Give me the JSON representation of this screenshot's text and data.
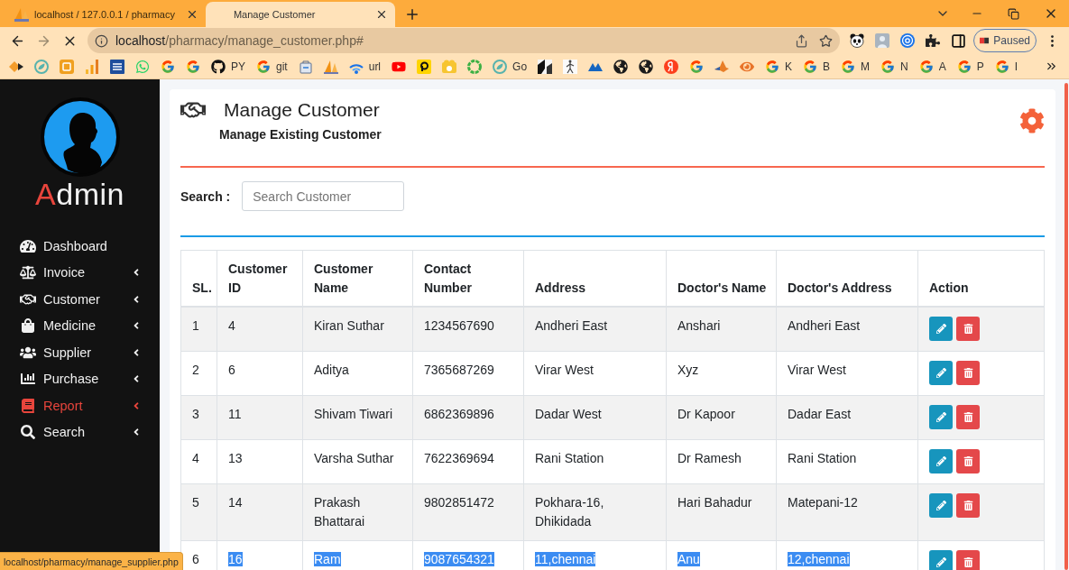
{
  "browser": {
    "tabs": [
      {
        "title": "localhost / 127.0.0.1 / pharmacy",
        "has_icon": true,
        "selected": false
      },
      {
        "title": "Manage Customer",
        "has_icon": false,
        "selected": true
      }
    ],
    "can_go_forward": false,
    "loading": true,
    "address": {
      "host": "localhost",
      "path": "/pharmacy/manage_customer.php#"
    },
    "profile_status": "Paused",
    "bookmarks": [
      {
        "kind": "icon"
      },
      {
        "kind": "icon"
      },
      {
        "kind": "icon"
      },
      {
        "kind": "icon"
      },
      {
        "kind": "icon"
      },
      {
        "kind": "icon"
      },
      {
        "kind": "icon"
      },
      {
        "kind": "icon"
      },
      {
        "kind": "labelled",
        "label": "PY"
      },
      {
        "kind": "labelled",
        "label": "git"
      },
      {
        "kind": "icon"
      },
      {
        "kind": "icon"
      },
      {
        "kind": "labelled",
        "label": "url"
      },
      {
        "kind": "icon"
      },
      {
        "kind": "icon"
      },
      {
        "kind": "icon"
      },
      {
        "kind": "icon"
      },
      {
        "kind": "labelled",
        "label": "Go"
      },
      {
        "kind": "icon"
      },
      {
        "kind": "icon"
      },
      {
        "kind": "icon"
      },
      {
        "kind": "icon"
      },
      {
        "kind": "icon"
      },
      {
        "kind": "icon"
      },
      {
        "kind": "icon"
      },
      {
        "kind": "icon"
      },
      {
        "kind": "icon"
      },
      {
        "kind": "labelled",
        "label": "K"
      },
      {
        "kind": "labelled",
        "label": "B"
      },
      {
        "kind": "labelled",
        "label": "M"
      },
      {
        "kind": "labelled",
        "label": "N"
      },
      {
        "kind": "labelled",
        "label": "A"
      },
      {
        "kind": "labelled",
        "label": "P"
      },
      {
        "kind": "labelled",
        "label": "I"
      }
    ]
  },
  "sidebar": {
    "brand": "Admin",
    "menu": [
      {
        "label": "Dashboard",
        "has_submenu": false,
        "selected": false
      },
      {
        "label": "Invoice",
        "has_submenu": true,
        "selected": false
      },
      {
        "label": "Customer",
        "has_submenu": true,
        "selected": false
      },
      {
        "label": "Medicine",
        "has_submenu": true,
        "selected": false
      },
      {
        "label": "Supplier",
        "has_submenu": true,
        "selected": false
      },
      {
        "label": "Purchase",
        "has_submenu": true,
        "selected": false
      },
      {
        "label": "Report",
        "has_submenu": true,
        "selected": true
      },
      {
        "label": "Search",
        "has_submenu": true,
        "selected": false
      }
    ]
  },
  "page": {
    "title": "Manage Customer",
    "subtitle": "Manage Existing Customer",
    "search_label": "Search :",
    "search_placeholder": "Search Customer"
  },
  "table": {
    "columns": [
      "SL.",
      "Customer ID",
      "Customer Name",
      "Contact Number",
      "Address",
      "Doctor's Name",
      "Doctor's Address",
      "Action"
    ],
    "rows": [
      {
        "cells": [
          "1",
          "4",
          "Kiran Suthar",
          "1234567690",
          "Andheri East",
          "Anshari",
          "Andheri East"
        ],
        "text_selected": false
      },
      {
        "cells": [
          "2",
          "6",
          "Aditya",
          "7365687269",
          "Virar West",
          "Xyz",
          "Virar West"
        ],
        "text_selected": false
      },
      {
        "cells": [
          "3",
          "11",
          "Shivam Tiwari",
          "6862369896",
          "Dadar West",
          "Dr Kapoor",
          "Dadar East"
        ],
        "text_selected": false
      },
      {
        "cells": [
          "4",
          "13",
          "Varsha Suthar",
          "7622369694",
          "Rani Station",
          "Dr Ramesh",
          "Rani Station"
        ],
        "text_selected": false
      },
      {
        "cells": [
          "5",
          "14",
          "Prakash Bhattarai",
          "9802851472",
          "Pokhara-16, Dhikidada",
          "Hari Bahadur",
          "Matepani-12"
        ],
        "text_selected": false
      },
      {
        "cells": [
          "6",
          "16",
          "Ram",
          "9087654321",
          "11,chennai",
          "Anu",
          "12,chennai"
        ],
        "text_selected": true
      }
    ]
  },
  "status_url": "localhost/pharmacy/manage_supplier.php"
}
